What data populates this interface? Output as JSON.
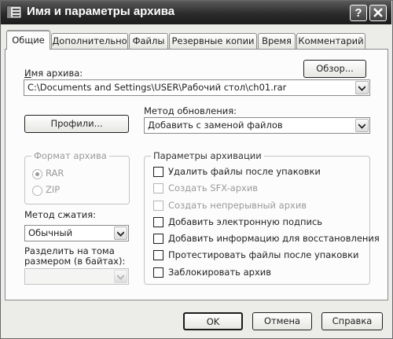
{
  "window": {
    "title": "Имя и параметры архива",
    "help_label": "?",
    "close_label": "X"
  },
  "tabs": [
    {
      "label": "Общие",
      "active": true
    },
    {
      "label": "Дополнительно"
    },
    {
      "label": "Файлы"
    },
    {
      "label": "Резервные копии"
    },
    {
      "label": "Время"
    },
    {
      "label": "Комментарий"
    }
  ],
  "archive_name": {
    "label": "Имя архива:",
    "browse_label": "Обзор...",
    "value": "C:\\Documents and Settings\\USER\\Рабочий стол\\ch01.rar"
  },
  "profiles_label": "Профили...",
  "update_method": {
    "label": "Метод обновления:",
    "value": "Добавить с заменой файлов"
  },
  "archive_format": {
    "legend": "Формат архива",
    "options": [
      {
        "label": "RAR",
        "selected": true
      },
      {
        "label": "ZIP",
        "selected": false
      }
    ]
  },
  "compression": {
    "label": "Метод сжатия:",
    "value": "Обычный"
  },
  "split": {
    "label_line1": "Разделить на тома",
    "label_line2": "размером (в байтах):",
    "value": ""
  },
  "options": {
    "legend": "Параметры архивации",
    "items": [
      {
        "label": "Удалить файлы после упаковки",
        "checked": false,
        "enabled": true
      },
      {
        "label": "Создать SFX-архив",
        "checked": false,
        "enabled": false
      },
      {
        "label": "Создать непрерывный архив",
        "checked": false,
        "enabled": false
      },
      {
        "label": "Добавить электронную подпись",
        "checked": false,
        "enabled": true
      },
      {
        "label": "Добавить информацию для восстановления",
        "checked": false,
        "enabled": true
      },
      {
        "label": "Протестировать файлы после упаковки",
        "checked": false,
        "enabled": true
      },
      {
        "label": "Заблокировать архив",
        "checked": false,
        "enabled": true
      }
    ]
  },
  "buttons": {
    "ok": "OK",
    "cancel": "Отмена",
    "help": "Справка"
  },
  "icons": {
    "app": "winrar-archive-icon",
    "combo_arrow": "chevron-down-icon"
  }
}
